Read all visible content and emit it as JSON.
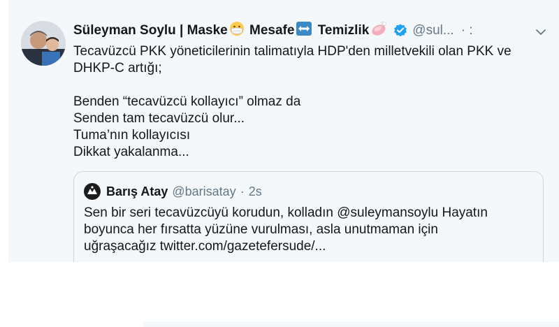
{
  "tweet": {
    "author": {
      "name_parts": [
        "Süleyman Soylu | Maske",
        " Mesafe",
        " Temizlik"
      ],
      "emojis": [
        "face-with-medical-mask-emoji",
        "left-right-arrow-emoji",
        "soap-emoji"
      ],
      "verified": true,
      "handle": "@sul...",
      "separator": "· :"
    },
    "body_lines": [
      "Tecavüzcü PKK yöneticilerinin talimatıyla HDP'den milletvekili olan PKK ve",
      "DHKP-C artığı;",
      "",
      "Benden “tecavüzcü kollayıcı” olmaz da",
      "Senden tam tecavüzcü olur...",
      "Tuma’nın kollayıcısı",
      "Dikkat yakalanma..."
    ],
    "quoted": {
      "name": "Barış Atay",
      "handle": "@barisatay",
      "separator": "·",
      "time": "2s",
      "text_lines": [
        "Sen bir seri tecavüzcüyü korudun, kolladın @suleymansoylu Hayatın",
        "boyunca her fırsatta yüzüne vurulması, asla unutmaman için",
        "uğraşacağız twitter.com/gazetefersude/..."
      ]
    }
  },
  "colors": {
    "card_bg": "#f5f8fa",
    "text": "#14171a",
    "secondary": "#657786",
    "verified_blue": "#1da1f2",
    "border": "#ccd6dd"
  },
  "icons": [
    "verified-badge-icon",
    "chevron-down-icon"
  ]
}
